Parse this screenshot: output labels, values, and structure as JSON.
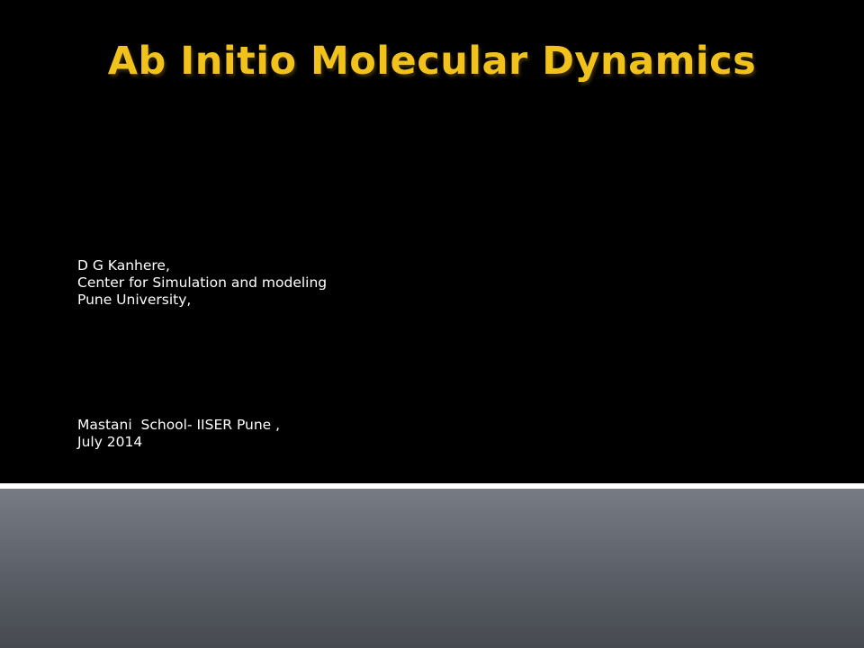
{
  "slide": {
    "title": "Ab Initio Molecular Dynamics",
    "author_lines": [
      "D G Kanhere,",
      "Center for Simulation and modeling",
      "Pune University,"
    ],
    "event_lines": [
      "Mastani  School- IISER Pune ,",
      "July 2014"
    ]
  },
  "colors": {
    "background_top": "#000000",
    "title": "#F2C21C",
    "body_text": "#FFFFFF",
    "divider": "#FFFFFF",
    "background_bottom": "#5F646D"
  }
}
